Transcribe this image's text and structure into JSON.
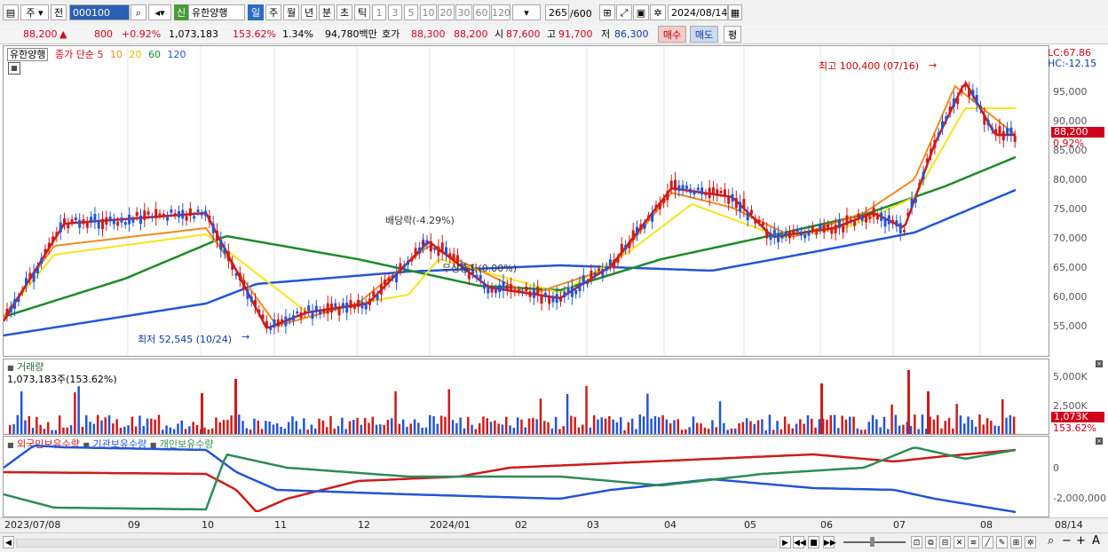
{
  "toolbar": {
    "period_left": "주",
    "prev_label": "전",
    "stock_code": "000100",
    "new_badge": "신",
    "stock_name": "유한양행",
    "periods": [
      "일",
      "주",
      "월",
      "년",
      "분",
      "초",
      "틱"
    ],
    "selected_period": "일",
    "intervals": [
      "1",
      "3",
      "5",
      "10",
      "20",
      "30",
      "60",
      "120"
    ],
    "count_value": "265",
    "count_total": "/600",
    "date_value": "2024/08/14"
  },
  "quote": {
    "price": "88,200",
    "change": "800",
    "change_pct": "+0.92%",
    "volume": "1,073,183",
    "volume_ratio": "153.62%",
    "turnover": "1.34%",
    "trade_value": "94,780백만",
    "ask_label": "호가",
    "ask": "88,300",
    "bid": "88,200",
    "open_label": "시",
    "open": "87,600",
    "high_label": "고",
    "high": "91,700",
    "low_label": "저",
    "low": "86,300",
    "buy_button": "매수",
    "sell_button": "매도",
    "eval_button": "평"
  },
  "price_pane": {
    "stock_label": "유한양행",
    "legend_prefix": "종가 단순",
    "ma_periods": [
      "5",
      "10",
      "20",
      "60",
      "120"
    ],
    "ma_colors": [
      "#d01a1a",
      "#f08a1c",
      "#f5e51a",
      "#1f8a2a",
      "#2255d6"
    ],
    "lc": "LC:67.86",
    "hc": "HC:-12.15",
    "y_ticks": [
      "95,000",
      "90,000",
      "85,000",
      "80,000",
      "75,000",
      "70,000",
      "65,000",
      "60,000",
      "55,000"
    ],
    "current_price_tag": "88,200",
    "current_pct_tag": "0.92%",
    "high_annotation": "최고 100,400 (07/16)",
    "low_annotation": "최저 52,545 (10/24)",
    "dividend_annotation": "배당락(-4.29%)",
    "free_issue_annotation": "무상증자(0.00%)"
  },
  "volume_pane": {
    "title": "거래량",
    "value_text": "1,073,183주(153.62%)",
    "y_ticks": [
      "5,000K",
      "2,500K"
    ],
    "current_tag": "1,073K",
    "ratio_tag": "153.62%"
  },
  "holdings_pane": {
    "series": [
      "외국인보유수량",
      "기관보유수량",
      "개인보유수량"
    ],
    "series_colors": [
      "#d01a1a",
      "#2255d6",
      "#2e8b57"
    ],
    "y_ticks": [
      "0",
      "-2,000,000"
    ]
  },
  "x_axis": {
    "labels": [
      "2023/07/08",
      "09",
      "10",
      "11",
      "12",
      "2024/01",
      "02",
      "03",
      "04",
      "05",
      "06",
      "07",
      "08"
    ],
    "end_label": "08/14"
  }
}
